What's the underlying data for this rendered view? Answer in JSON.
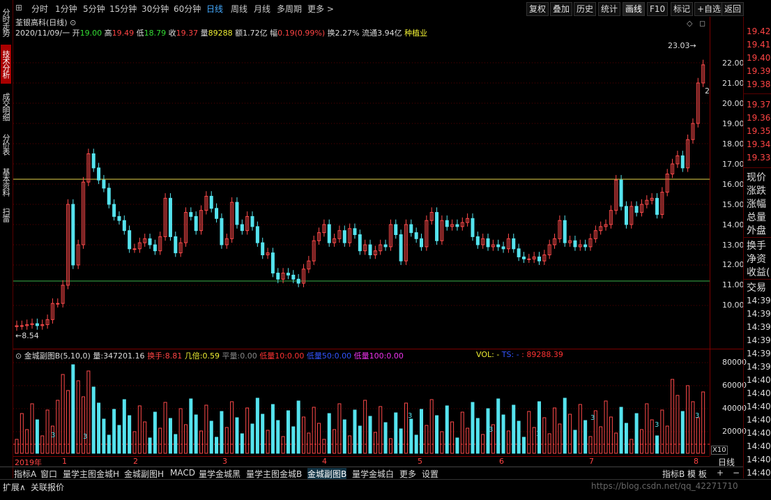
{
  "left_tabs": [
    {
      "label": "分时走势",
      "active": false
    },
    {
      "label": "技术分析",
      "active": true
    },
    {
      "label": "成交明细",
      "active": false
    },
    {
      "label": "分价表",
      "active": false
    },
    {
      "label": "基本资料",
      "active": false
    },
    {
      "label": "扫雷",
      "active": false
    }
  ],
  "toolbar": {
    "period_tabs": [
      "分时",
      "1分钟",
      "5分钟",
      "15分钟",
      "30分钟",
      "60分钟",
      "日线",
      "周线",
      "月线",
      "多周期",
      "更多 >"
    ],
    "active_period": "日线",
    "right_buttons": [
      "复权",
      "叠加",
      "历史",
      "统计",
      "画线",
      "F10",
      "标记",
      "+自选",
      "返回"
    ],
    "active_right": "画线"
  },
  "main_chart": {
    "title": "荃银高科(日线)",
    "bar_info": {
      "date": "2020/11/09/一",
      "open_label": "开",
      "open": "19.00",
      "high_label": "高",
      "high": "19.49",
      "low_label": "低",
      "low": "18.79",
      "close_label": "收",
      "close": "19.37",
      "volume_label": "量",
      "volume": "89288",
      "amount_label": "额",
      "amount": "1.72亿",
      "change_label": "幅",
      "change": "0.19(0.99%)",
      "turnover_label": "换",
      "turnover": "2.27%",
      "float_label": "流通",
      "float": "3.94亿",
      "sector": "种植业"
    },
    "high_marker": "23.03",
    "low_marker": "8.54",
    "signal_digit": "2"
  },
  "price_axis": {
    "ticks": [
      "22.00",
      "21.00",
      "20.00",
      "19.00",
      "18.00",
      "17.00",
      "16.00",
      "15.00",
      "14.00",
      "13.00",
      "12.00",
      "11.00",
      "10.00"
    ]
  },
  "volume_chart": {
    "indicator_name": "金城副图B(5,10,0)",
    "vol_label": "量:",
    "vol_value": "347201.16",
    "hs_label": "换手:",
    "hs_value": "8.81",
    "beishu_label": "几倍:",
    "beishu_value": "0.59",
    "pl_label": "平量:",
    "pl_value": "0.00",
    "dl10_label": "低量10:",
    "dl10_value": "0.00",
    "dl50_label": "低量50:",
    "dl50_value": "0.00",
    "dl100_label": "低量100:",
    "dl100_value": "0.00",
    "vol_tail": "VOL: -",
    "ts_tail": "TS: -",
    "vol_last": ": 89288.39",
    "axis_ticks": [
      "80000",
      "60000",
      "40000",
      "20000"
    ],
    "axis_unit": "X10",
    "signal_label": "3"
  },
  "time_axis": {
    "labels": [
      "2019年",
      "1",
      "2",
      "3",
      "4",
      "5",
      "6",
      "7",
      "8"
    ],
    "period_button": "日线"
  },
  "quote_panel": {
    "ask_prices": [
      "19.42",
      "19.41",
      "19.40",
      "19.39",
      "19.38"
    ],
    "bid_prices": [
      "19.37",
      "19.36",
      "19.35",
      "19.34",
      "19.33"
    ],
    "fields": [
      "现价",
      "涨跌",
      "涨幅",
      "总量",
      "外盘"
    ],
    "fields2": [
      "换手",
      "净资",
      "收益("
    ],
    "trade_header": "交易",
    "trade_times": [
      "14:39",
      "14:39",
      "14:39",
      "14:39",
      "14:39",
      "14:39",
      "14:40",
      "14:40",
      "14:40",
      "14:40",
      "14:40",
      "14:40",
      "14:40",
      "14:40",
      "14:40",
      "14:40"
    ]
  },
  "bottom_tabs": {
    "left_button": "指标A",
    "tabs": [
      "窗口",
      "量学主图金城H",
      "金城副图H",
      "MACD",
      "量学金城黑",
      "量学主图金城B",
      "金城副图B",
      "量学金城白",
      "更多",
      "设置"
    ],
    "active_tab": "金城副图B",
    "right_buttons": [
      "指标B",
      "模 板",
      "+",
      "−"
    ]
  },
  "status_bar": {
    "expand": "扩展∧",
    "linked_quote": "关联报价",
    "watermark": "https://blog.csdn.net/qq_42271710"
  },
  "colors": {
    "up": "#ff4a4a",
    "down": "#55e3ee",
    "ma_line_upper": "#e6d44a",
    "ma_line_lower": "#3cb04a",
    "frame": "#7a0000"
  }
}
